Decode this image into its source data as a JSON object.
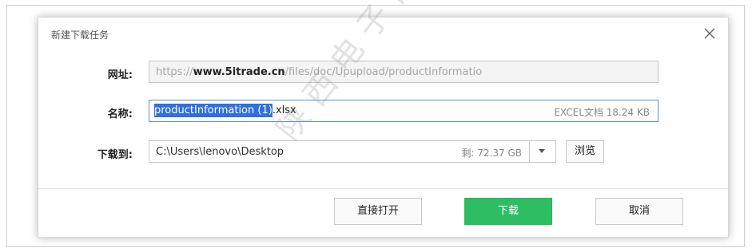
{
  "dialog": {
    "title": "新建下载任务"
  },
  "url_row": {
    "label": "网址:",
    "value_prefix": "https://",
    "value_host": "www.5itrade.cn",
    "value_path": "/files/doc/Upupload/productInformatio"
  },
  "name_row": {
    "label": "名称:",
    "selected_text": "productInformation (1)",
    "extension": ".xlsx",
    "file_meta": "EXCEL文档 18.24 KB"
  },
  "path_row": {
    "label": "下载到:",
    "path": "C:\\Users\\lenovo\\Desktop",
    "free_space": "剩: 72.37 GB",
    "browse_label": "浏览"
  },
  "buttons": {
    "open_label": "直接打开",
    "download_label": "下载",
    "cancel_label": "取消"
  },
  "watermark": "陕西电子口岸"
}
